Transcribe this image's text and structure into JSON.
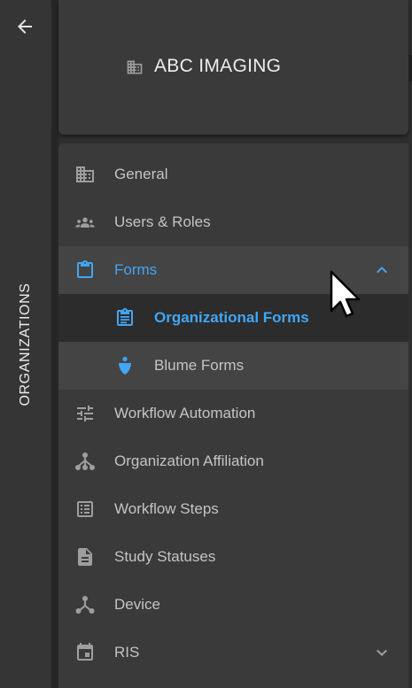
{
  "rail": {
    "label": "ORGANIZATIONS",
    "back_icon": "arrow-left-icon"
  },
  "header": {
    "icon": "building-icon",
    "title": "ABC IMAGING"
  },
  "menu": {
    "items": [
      {
        "label": "General",
        "icon": "building-icon"
      },
      {
        "label": "Users & Roles",
        "icon": "groups-icon"
      },
      {
        "label": "Forms",
        "icon": "clipboard-icon",
        "expanded": true
      },
      {
        "label": "Organizational Forms",
        "icon": "clipboard-list-icon",
        "selected": true
      },
      {
        "label": "Blume Forms",
        "icon": "blume-drop-icon"
      },
      {
        "label": "Workflow Automation",
        "icon": "tune-icon"
      },
      {
        "label": "Organization Affiliation",
        "icon": "hub-icon"
      },
      {
        "label": "Workflow Steps",
        "icon": "list-box-icon"
      },
      {
        "label": "Study Statuses",
        "icon": "document-icon"
      },
      {
        "label": "Device",
        "icon": "share-icon"
      },
      {
        "label": "RIS",
        "icon": "calendar-icon",
        "expanded": false
      }
    ]
  },
  "colors": {
    "accent": "#42a5f5",
    "text": "#c4c4c4",
    "background": "#3a3a3a"
  }
}
